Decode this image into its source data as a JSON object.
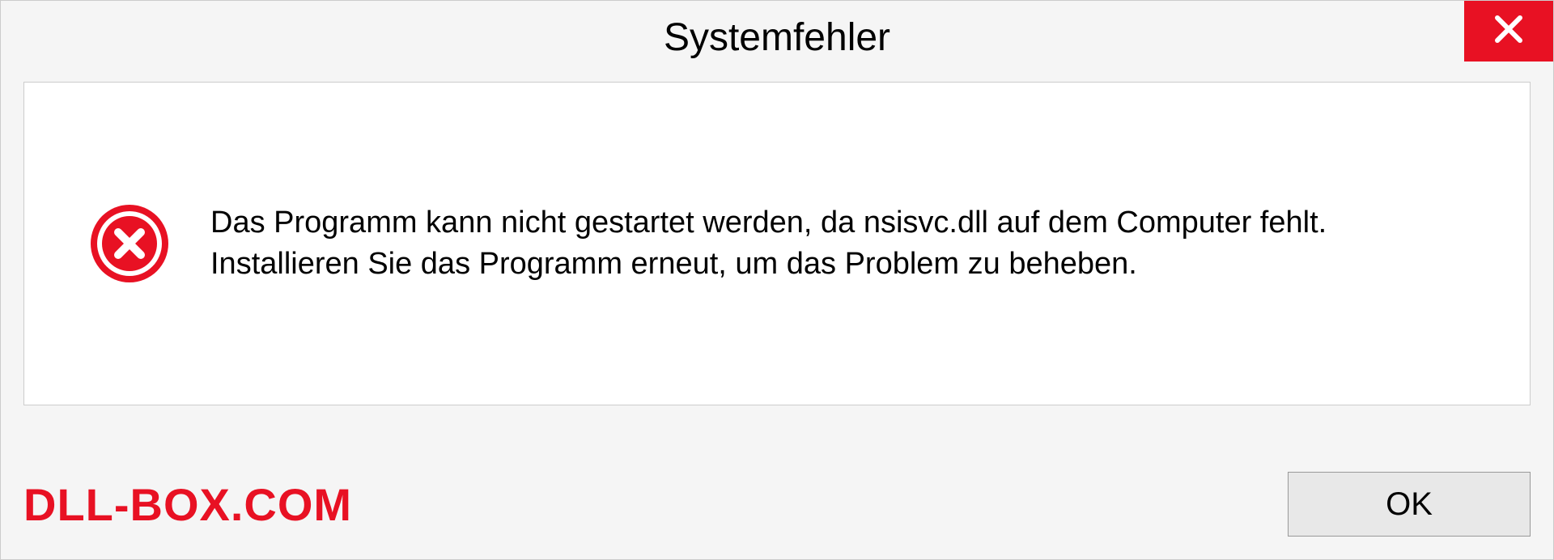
{
  "dialog": {
    "title": "Systemfehler",
    "message": "Das Programm kann nicht gestartet werden, da nsisvc.dll auf dem Computer fehlt. Installieren Sie das Programm erneut, um das Problem zu beheben.",
    "ok_label": "OK"
  },
  "watermark": "DLL-BOX.COM"
}
